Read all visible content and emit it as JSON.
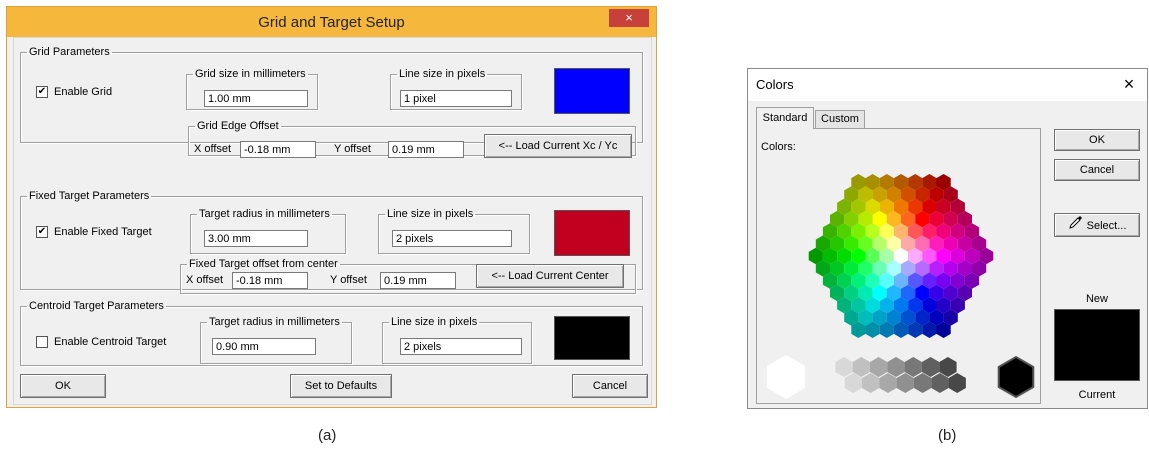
{
  "colors": {
    "grid_swatch": "#0000ff",
    "fixed_swatch": "#c0001e",
    "centroid_swatch": "#000000",
    "new_color": "#000000",
    "title_bar": "#f5b83c",
    "close_bg": "#c7403a"
  },
  "grid_setup": {
    "title": "Grid and Target Setup",
    "close": "×",
    "grid": {
      "legend": "Grid Parameters",
      "enable_label": "Enable Grid",
      "enable_check": "✔",
      "size_label": "Grid size in millimeters",
      "size_value": "1.00 mm",
      "line_label": "Line size in pixels",
      "line_value": "1 pixel",
      "edge_legend": "Grid Edge  Offset",
      "x_label": "X offset",
      "x_value": "-0.18 mm",
      "y_label": "Y offset",
      "y_value": "0.19 mm",
      "load_button": "<-- Load Current  Xc / Yc"
    },
    "fixed": {
      "legend": "Fixed Target Parameters",
      "enable_label": "Enable Fixed Target",
      "enable_check": "✔",
      "radius_label": "Target radius in millimeters",
      "radius_value": "3.00 mm",
      "line_label": "Line size in pixels",
      "line_value": "2 pixels",
      "offset_legend": "Fixed Target offset from center",
      "x_label": "X offset",
      "x_value": "-0.18 mm",
      "y_label": "Y offset",
      "y_value": "0.19 mm",
      "load_button": "<-- Load Current Center"
    },
    "centroid": {
      "legend": "Centroid Target Parameters",
      "enable_label": "Enable Centroid Target",
      "radius_label": "Target radius in millimeters",
      "radius_value": "0.90 mm",
      "line_label": "Line size in pixels",
      "line_value": "2 pixels"
    },
    "ok_button": "OK",
    "defaults_button": "Set to Defaults",
    "cancel_button": "Cancel"
  },
  "colors_dialog": {
    "title": "Colors",
    "close": "×",
    "tab_standard": "Standard",
    "tab_custom": "Custom",
    "colors_label": "Colors:",
    "ok_button": "OK",
    "cancel_button": "Cancel",
    "select_button": "Select...",
    "new_label": "New",
    "current_label": "Current"
  },
  "captions": {
    "a": "(a)",
    "b": "(b)"
  }
}
